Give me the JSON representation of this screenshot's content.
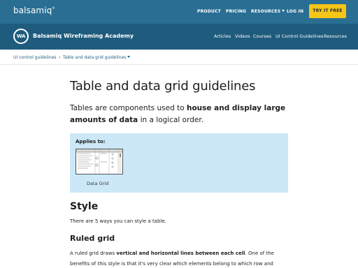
{
  "top_bar": {
    "logo": "balsamiq",
    "logo_mark": "®",
    "nav": [
      "PRODUCT",
      "PRICING",
      "RESOURCES",
      "LOG IN"
    ],
    "cta": "TRY IT FREE",
    "background": "#2a6f93",
    "cta_color": "#f5c518"
  },
  "academy_bar": {
    "badge": "WA",
    "title": "Balsamiq Wireframing Academy",
    "links": [
      "Articles",
      "Videos",
      "Courses",
      "UI Control Guidelines",
      "Resources"
    ],
    "background": "#1e5b7d"
  },
  "breadcrumb": {
    "items": [
      "UI control guidelines",
      "Table and data grid guidelines"
    ],
    "separator": "›"
  },
  "main": {
    "title": "Table and data grid guidelines",
    "lead": {
      "before": "Tables are components used to ",
      "bold": "house and display large amounts of data",
      "after": " in a logical order."
    },
    "applies_to": {
      "label": "Applies to:",
      "items": [
        {
          "caption": "Data Grid",
          "icon": "data-grid-thumbnail"
        }
      ],
      "background": "#cce8f8"
    },
    "style_heading": "Style",
    "style_intro": "There are 5 ways you can style a table.",
    "ruled_heading": "Ruled grid",
    "ruled_text": {
      "before": "A ruled grid draws ",
      "bold": "vertical and horizontal lines between each cell",
      "after": ". One of the benefits of this style is that it's very clear which elements belong to which row and"
    }
  }
}
